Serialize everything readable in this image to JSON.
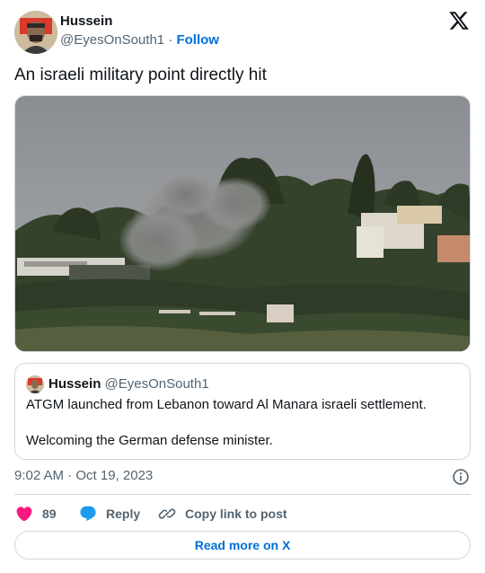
{
  "author": {
    "name": "Hussein",
    "handle": "@EyesOnSouth1",
    "separator": "·",
    "follow_label": "Follow"
  },
  "tweet": {
    "text": "An israeli military point directly hit"
  },
  "media": {
    "icon": "photo"
  },
  "quoted": {
    "name": "Hussein",
    "handle": "@EyesOnSouth1",
    "line1": "ATGM launched from Lebanon toward Al Manara israeli settlement.",
    "line2": "Welcoming the German defense minister."
  },
  "meta": {
    "timestamp": "9:02 AM · Oct 19, 2023"
  },
  "actions": {
    "like_count": "89",
    "reply_label": "Reply",
    "copy_label": "Copy link to post"
  },
  "footer": {
    "read_more_label": "Read more on X"
  },
  "colors": {
    "accent": "#006fd6",
    "like": "#f91880",
    "reply": "#1d9bf0",
    "muted": "#536471",
    "border": "#cfd9de"
  }
}
